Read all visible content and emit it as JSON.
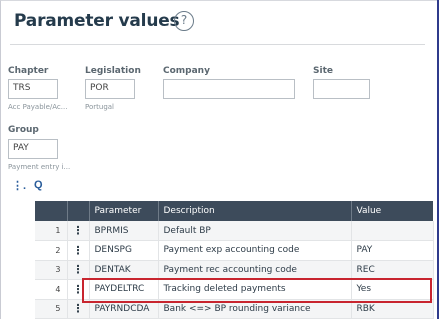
{
  "page": {
    "title": "Parameter values",
    "help_icon": "?"
  },
  "filters": {
    "chapter": {
      "label": "Chapter",
      "value": "TRS",
      "subtext": "Acc Payable/Ac..."
    },
    "legislation": {
      "label": "Legislation",
      "value": "POR",
      "subtext": "Portugal"
    },
    "company": {
      "label": "Company",
      "value": ""
    },
    "site": {
      "label": "Site",
      "value": ""
    },
    "group": {
      "label": "Group",
      "value": "PAY",
      "subtext": "Payment entry i..."
    }
  },
  "toolbar": {
    "rows_icon": "⋮.",
    "search_icon": "Q"
  },
  "table": {
    "headers": {
      "parameter": "Parameter",
      "description": "Description",
      "value": "Value"
    },
    "rows": [
      {
        "num": "1",
        "menu": "⋮",
        "parameter": "BPRMIS",
        "description": "Default BP",
        "value": ""
      },
      {
        "num": "2",
        "menu": "⋮",
        "parameter": "DENSPG",
        "description": "Payment exp accounting code",
        "value": "PAY"
      },
      {
        "num": "3",
        "menu": "⋮",
        "parameter": "DENTAK",
        "description": "Payment rec accounting code",
        "value": "REC"
      },
      {
        "num": "4",
        "menu": "⋮",
        "parameter": "PAYDELTRC",
        "description": "Tracking deleted payments",
        "value": "Yes"
      },
      {
        "num": "5",
        "menu": "⋮",
        "parameter": "PAYRNDCDA",
        "description": "Bank <=> BP rounding variance",
        "value": "RBK"
      }
    ]
  }
}
